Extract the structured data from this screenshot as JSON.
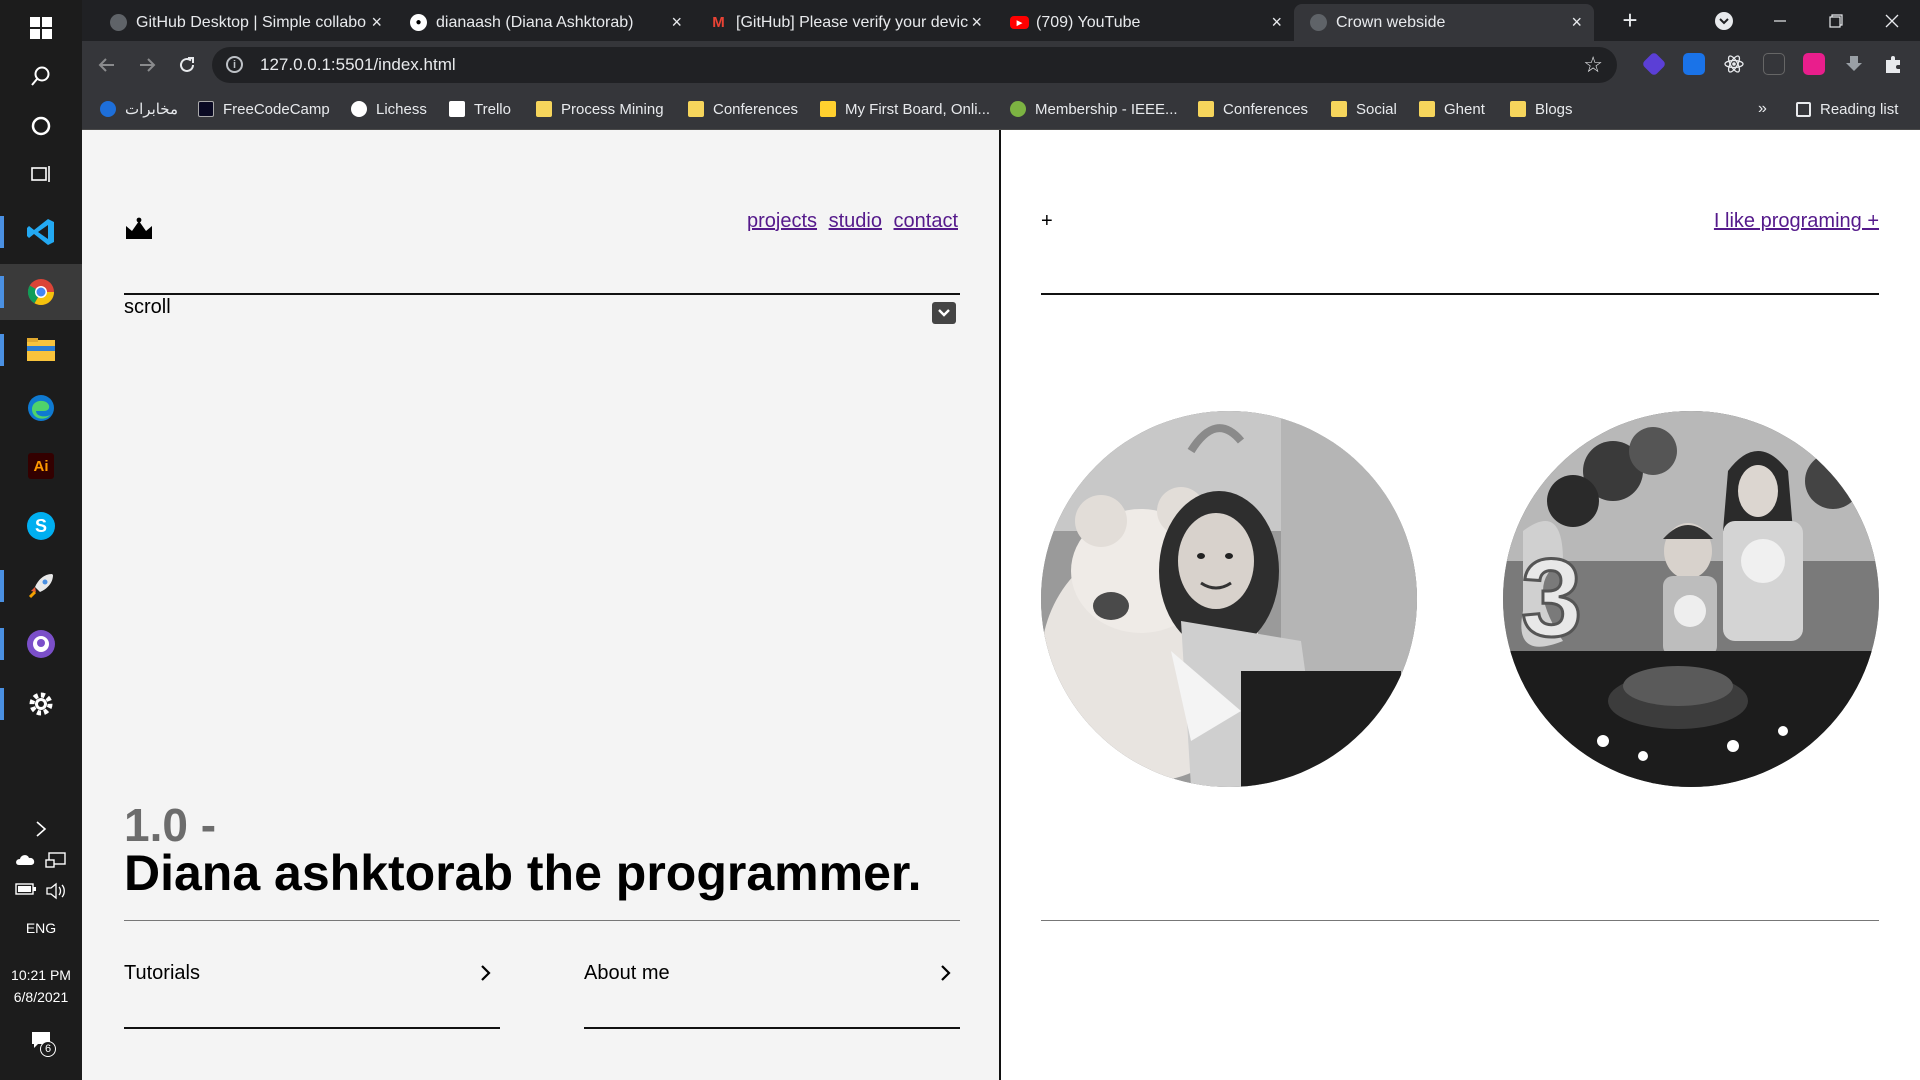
{
  "taskbar": {
    "tray_lang": "ENG",
    "clock_time": "10:21 PM",
    "clock_date": "6/8/2021",
    "notification_count": "6"
  },
  "browser": {
    "tabs": [
      {
        "title": "GitHub Desktop | Simple collabo"
      },
      {
        "title": "dianaash (Diana Ashktorab)"
      },
      {
        "title": "[GitHub] Please verify your devic"
      },
      {
        "title": "(709) YouTube"
      },
      {
        "title": "Crown webside"
      }
    ],
    "url": "127.0.0.1:5501/index.html",
    "bookmarks": [
      {
        "label": "مخابرات"
      },
      {
        "label": "FreeCodeCamp"
      },
      {
        "label": "Lichess"
      },
      {
        "label": "Trello"
      },
      {
        "label": "Process Mining"
      },
      {
        "label": "Conferences"
      },
      {
        "label": "My First Board, Onli..."
      },
      {
        "label": "Membership - IEEE..."
      },
      {
        "label": "Conferences"
      },
      {
        "label": "Social"
      },
      {
        "label": "Ghent"
      },
      {
        "label": "Blogs"
      }
    ],
    "bookmarks_overflow": "»",
    "reading_list": "Reading list"
  },
  "site": {
    "nav": [
      "projects",
      "studio",
      "contact"
    ],
    "scroll_label": "scroll",
    "version": "1.0 -",
    "headline": "Diana ashktorab the programmer.",
    "cards": [
      {
        "label": "Tutorials"
      },
      {
        "label": "About me"
      }
    ],
    "plus": "+",
    "right_link": "I like programing +"
  }
}
